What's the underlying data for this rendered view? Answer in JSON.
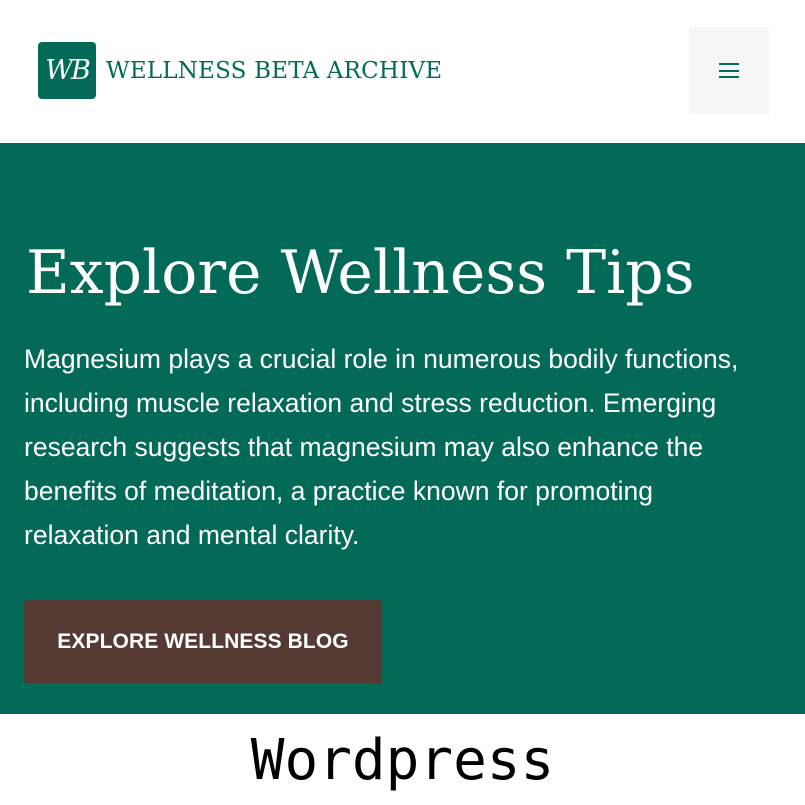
{
  "header": {
    "logo_text": "WB",
    "site_title": "WELLNESS BETA ARCHIVE",
    "menu_icon": "hamburger-menu-icon"
  },
  "hero": {
    "title": "Explore Wellness Tips",
    "body": "Magnesium plays a crucial role in numerous bodily functions, including muscle relaxation and stress reduction. Emerging research suggests that magnesium may also enhance the benefits of meditation, a practice known for promoting relaxation and mental clarity.",
    "button_label": "EXPLORE WELLNESS BLOG"
  },
  "caption": {
    "text": "Wordpress"
  },
  "colors": {
    "brand_green": "#026a57",
    "button_brown": "#543a33",
    "header_bg": "#ffffff",
    "menu_button_bg": "#f5f5f5"
  }
}
